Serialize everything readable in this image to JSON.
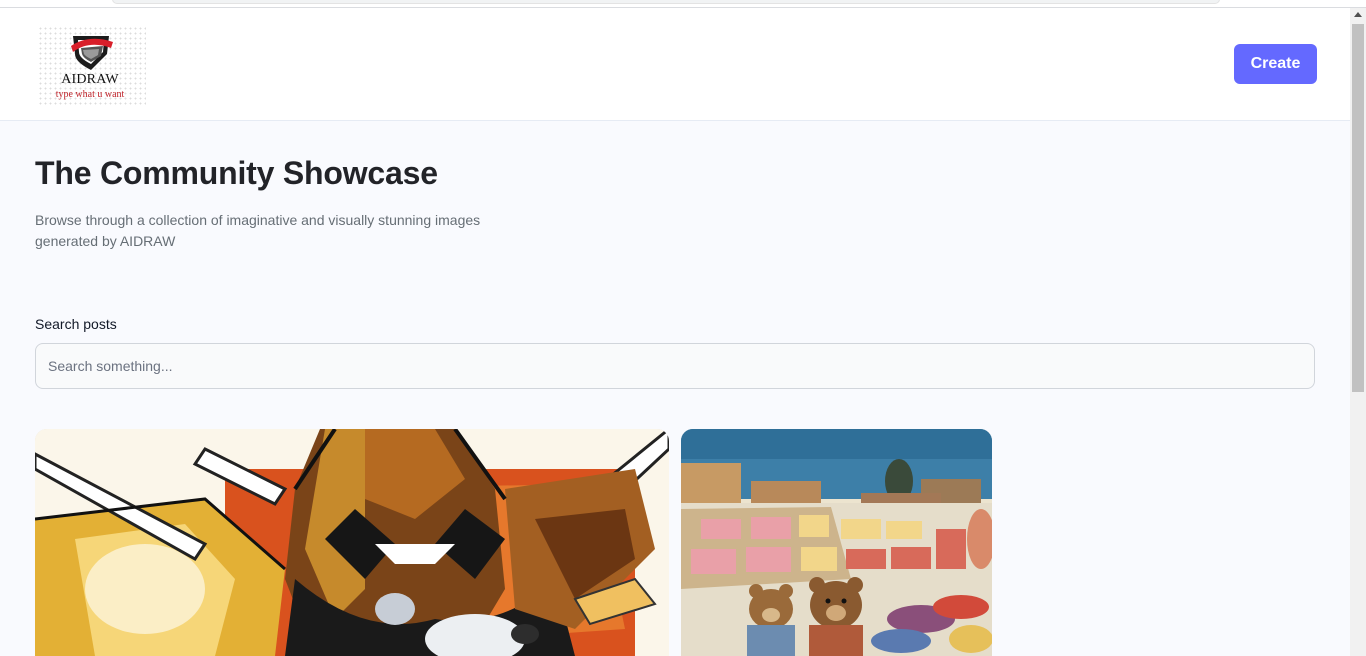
{
  "header": {
    "logo_name": "AIDRAW",
    "logo_tagline": "type what u want",
    "create_label": "Create"
  },
  "main": {
    "title": "The Community Showcase",
    "subtitle": "Browse through a collection of imaginative and visually stunning images generated by AIDRAW",
    "search": {
      "label": "Search posts",
      "placeholder": "Search something...",
      "value": ""
    }
  },
  "gallery": {
    "posts": [
      {
        "image": "abstract-robot-painting"
      },
      {
        "image": "teddy-bears-at-market-painting"
      }
    ]
  },
  "colors": {
    "accent": "#6469ff",
    "title": "#222328",
    "subtitle": "#666e75",
    "background": "#f9fafe"
  }
}
